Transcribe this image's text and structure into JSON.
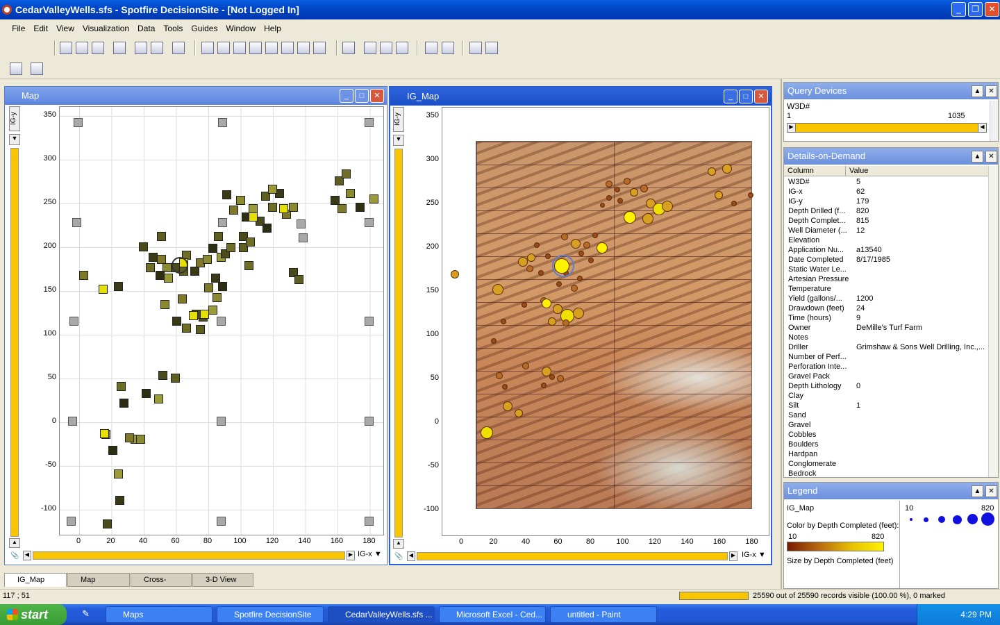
{
  "window_title": "CedarValleyWells.sfs - Spotfire DecisionSite - [Not Logged In]",
  "menu": [
    "File",
    "Edit",
    "View",
    "Visualization",
    "Data",
    "Tools",
    "Guides",
    "Window",
    "Help"
  ],
  "map_window": {
    "title": "Map",
    "y_axis_label": "IG-y",
    "x_axis_label": "IG-x",
    "y_ticks": [
      "350",
      "300",
      "250",
      "200",
      "150",
      "100",
      "50",
      "0",
      "-50",
      "-100"
    ],
    "x_ticks": [
      "0",
      "20",
      "40",
      "60",
      "80",
      "100",
      "120",
      "140",
      "160",
      "180"
    ]
  },
  "igmap_window": {
    "title": "IG_Map",
    "y_axis_label": "IG-y",
    "x_axis_label": "IG-x",
    "y_ticks": [
      "350",
      "300",
      "250",
      "200",
      "150",
      "100",
      "50",
      "0",
      "-50",
      "-100"
    ],
    "x_ticks": [
      "0",
      "20",
      "40",
      "60",
      "80",
      "100",
      "120",
      "140",
      "160",
      "180"
    ]
  },
  "query_devices": {
    "title": "Query Devices",
    "field": "W3D#",
    "min": "1",
    "max": "1035"
  },
  "details_on_demand": {
    "title": "Details-on-Demand",
    "col_header": "Column",
    "val_header": "Value",
    "rows": [
      {
        "c": "W3D#",
        "v": "5"
      },
      {
        "c": "IG-x",
        "v": "62"
      },
      {
        "c": "IG-y",
        "v": "179"
      },
      {
        "c": "Depth Drilled (f...",
        "v": "820"
      },
      {
        "c": "Depth Complet...",
        "v": "815"
      },
      {
        "c": "Well Diameter (...",
        "v": "12"
      },
      {
        "c": "Elevation",
        "v": ""
      },
      {
        "c": "Application Nu...",
        "v": "a13540"
      },
      {
        "c": "Date Completed",
        "v": "8/17/1985"
      },
      {
        "c": "Static Water Le...",
        "v": ""
      },
      {
        "c": "Artesian Pressure",
        "v": ""
      },
      {
        "c": "Temperature",
        "v": ""
      },
      {
        "c": "Yield (gallons/...",
        "v": "1200"
      },
      {
        "c": "Drawdown (feet)",
        "v": "24"
      },
      {
        "c": "Time (hours)",
        "v": "9"
      },
      {
        "c": "Owner",
        "v": "DeMille's Turf Farm"
      },
      {
        "c": "Notes",
        "v": ""
      },
      {
        "c": "Driller",
        "v": "Grimshaw & Sons Well Drilling, Inc.,..."
      },
      {
        "c": "Number of Perf...",
        "v": ""
      },
      {
        "c": "Perforation Inte...",
        "v": ""
      },
      {
        "c": "Gravel Pack",
        "v": ""
      },
      {
        "c": "Depth Lithology",
        "v": "0"
      },
      {
        "c": "Clay",
        "v": ""
      },
      {
        "c": "Silt",
        "v": "1"
      },
      {
        "c": "Sand",
        "v": ""
      },
      {
        "c": "Gravel",
        "v": ""
      },
      {
        "c": "Cobbles",
        "v": ""
      },
      {
        "c": "Boulders",
        "v": ""
      },
      {
        "c": "Hardpan",
        "v": ""
      },
      {
        "c": "Conglomerate",
        "v": ""
      },
      {
        "c": "Bedrock",
        "v": ""
      }
    ]
  },
  "legend": {
    "title": "Legend",
    "viz": "IG_Map",
    "color_label": "Color by Depth Completed (feet):",
    "color_min": "10",
    "color_max": "820",
    "size_label": "Size by Depth Completed (feet)",
    "size_min": "10",
    "size_max": "820"
  },
  "tabs": [
    "IG_Map",
    "Map",
    "Cross-Section",
    "3-D View"
  ],
  "status": {
    "coords": "117 ; 51",
    "records": "25590 out of 25590 records visible (100.00 %), 0 marked"
  },
  "taskbar": {
    "start": "start",
    "tasks": [
      "Maps",
      "Spotfire DecisionSite",
      "CedarValleyWells.sfs ...",
      "Microsoft Excel - Ced...",
      "untitled - Paint"
    ],
    "clock": "4:29 PM"
  }
}
